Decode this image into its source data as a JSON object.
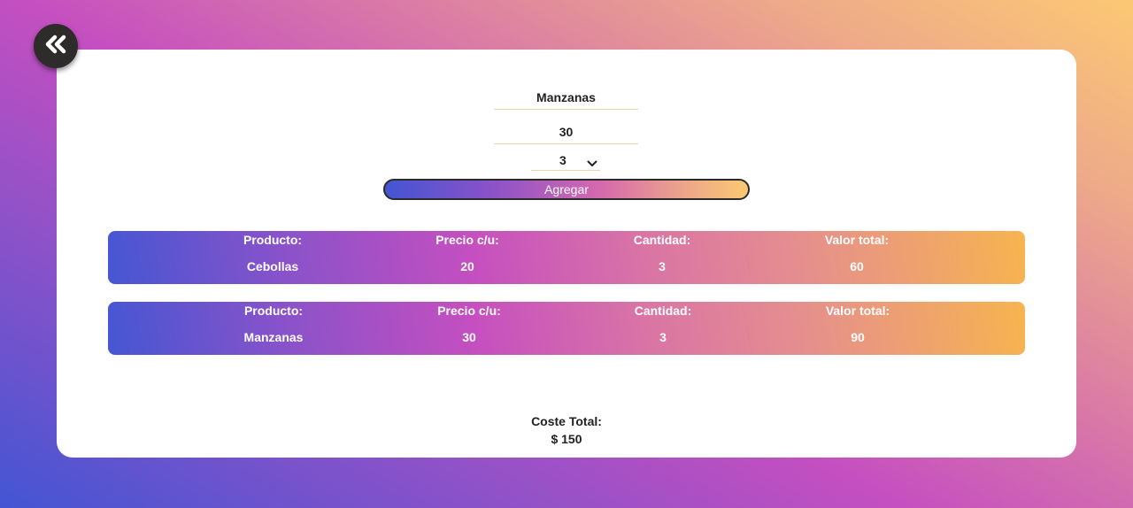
{
  "back_button": {
    "icon": "double-chevron-left-icon"
  },
  "form": {
    "product_name_value": "Manzanas",
    "price_value": "30",
    "quantity_selected": "3",
    "add_button_label": "Agregar"
  },
  "table": {
    "headers": {
      "product": "Producto:",
      "price": "Precio c/u:",
      "quantity": "Cantidad:",
      "total": "Valor total:"
    },
    "rows": [
      {
        "product": "Cebollas",
        "price": "20",
        "quantity": "3",
        "total": "60"
      },
      {
        "product": "Manzanas",
        "price": "30",
        "quantity": "3",
        "total": "90"
      }
    ]
  },
  "summary": {
    "label": "Coste Total:",
    "value": "$ 150"
  },
  "colors": {
    "background_gradient": [
      "#4355d3",
      "#c54fc0",
      "#fcc874"
    ],
    "row_gradient": [
      "#4556d3",
      "#c54fc0",
      "#f7b44f"
    ],
    "back_button_bg": "#2e2b2b",
    "field_underline": "#e8d8a8"
  }
}
